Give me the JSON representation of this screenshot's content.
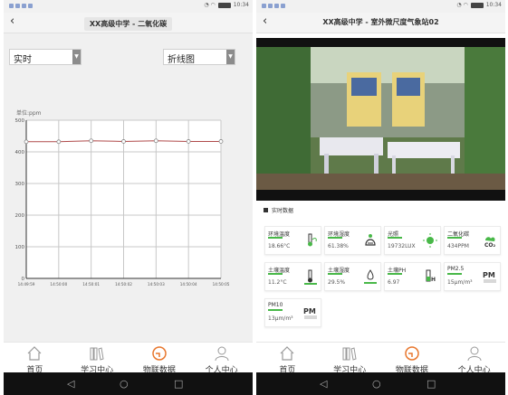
{
  "left": {
    "status": {
      "time": "10:34"
    },
    "title": "XX高级中学 - 二氧化碳",
    "realtime_select": "实时",
    "charttype_select": "折线图",
    "chart_data": {
      "type": "line",
      "unit_label": "单位:ppm",
      "x": [
        "14:49:59",
        "14:50:00",
        "14:50:01",
        "14:50:02",
        "14:50:03",
        "14:50:04",
        "14:50:05"
      ],
      "series": [
        {
          "values": [
            432,
            432,
            435,
            433,
            435,
            433,
            433
          ]
        }
      ],
      "yticks": [
        0,
        100,
        200,
        300,
        400,
        500
      ],
      "ylim": [
        0,
        500
      ],
      "grid": true,
      "line_color": "#b04a4a"
    }
  },
  "right": {
    "status": {
      "time": "10:34"
    },
    "title": "XX高级中学 - 室外微尺度气象站02",
    "section_title": "实时数据",
    "sensors": [
      {
        "name": "环境温度",
        "value": "18.66°C",
        "icon": "thermometer-plant-icon"
      },
      {
        "name": "环境湿度",
        "value": "61.38%",
        "icon": "humidity-icon"
      },
      {
        "name": "光照",
        "value": "19732LUX",
        "icon": "sun-icon"
      },
      {
        "name": "二氧化碳",
        "value": "434PPM",
        "icon": "co2-icon"
      },
      {
        "name": "土壤温度",
        "value": "11.2°C",
        "icon": "soil-thermometer-icon"
      },
      {
        "name": "土壤湿度",
        "value": "29.5%",
        "icon": "soil-humidity-icon"
      },
      {
        "name": "土壤PH",
        "value": "6.97",
        "icon": "ph-icon"
      },
      {
        "name": "PM2.5",
        "value": "15μm/m³",
        "icon": "pm-icon"
      },
      {
        "name": "PM10",
        "value": "13μm/m³",
        "icon": "pm-icon"
      }
    ]
  },
  "tabs": [
    {
      "label": "首页",
      "icon": "home-icon"
    },
    {
      "label": "学习中心",
      "icon": "books-icon"
    },
    {
      "label": "物联数据",
      "icon": "iot-data-icon"
    },
    {
      "label": "个人中心",
      "icon": "user-icon"
    }
  ],
  "colors": {
    "accent": "#e8762c",
    "line": "#b04a4a",
    "green": "#48b848"
  }
}
